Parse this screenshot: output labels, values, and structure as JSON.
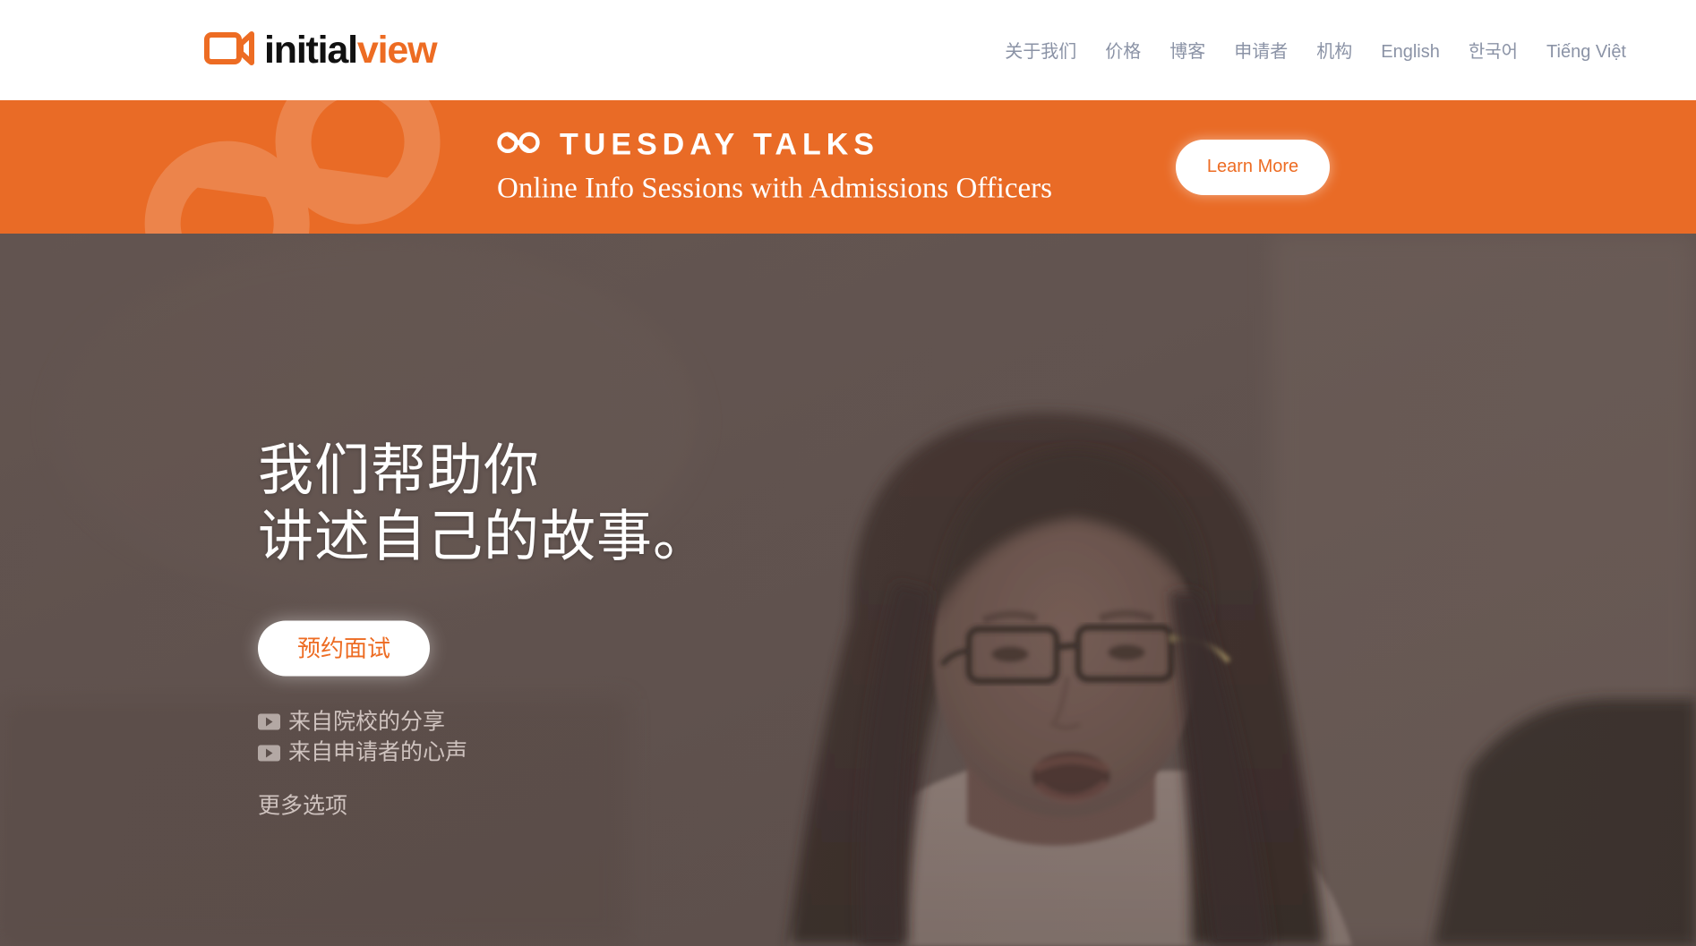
{
  "header": {
    "logo": {
      "icon": "video-camera-icon",
      "word_dark": "initial",
      "word_accent": "view"
    },
    "nav": [
      {
        "label": "关于我们",
        "latin": false
      },
      {
        "label": "价格",
        "latin": false
      },
      {
        "label": "博客",
        "latin": false
      },
      {
        "label": "申请者",
        "latin": false
      },
      {
        "label": "机构",
        "latin": false
      },
      {
        "label": "English",
        "latin": true
      },
      {
        "label": "한국어",
        "latin": true
      },
      {
        "label": "Tiếng Việt",
        "latin": true
      }
    ]
  },
  "banner": {
    "icon": "infinity-link-icon",
    "title": "TUESDAY TALKS",
    "subtitle": "Online Info Sessions with Admissions Officers",
    "cta_label": "Learn More",
    "background_color": "#E96B26",
    "watermark_icon": "infinity-link-watermark"
  },
  "hero": {
    "heading": "我们帮助你\n讲述自己的故事。",
    "cta_label": "预约面试",
    "video_links": [
      {
        "icon": "play-icon",
        "label": "来自院校的分享"
      },
      {
        "icon": "play-icon",
        "label": "来自申请者的心声"
      }
    ],
    "more_options_label": "更多选项",
    "overlay_color": "#5e514d"
  },
  "colors": {
    "accent_orange": "#ED6C23",
    "banner_orange": "#E96B26",
    "nav_text": "#8b93a6",
    "hero_muted_text": "#cfc3bf"
  }
}
